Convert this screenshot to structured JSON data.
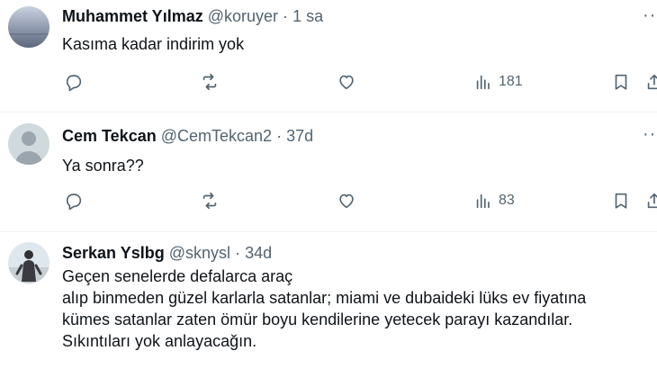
{
  "tweets": [
    {
      "name": "Muhammet Yılmaz",
      "handle": "@koruyer",
      "sep": "·",
      "time": "1 sa",
      "text": "Kasıma kadar indirim yok",
      "views": "181"
    },
    {
      "name": "Cem Tekcan",
      "handle": "@CemTekcan2",
      "sep": "·",
      "time": "37d",
      "text": "Ya sonra??",
      "views": "83"
    },
    {
      "name": "Serkan Yslbg",
      "handle": "@sknysl",
      "sep": "·",
      "time": "34d",
      "text": "Geçen senelerde defalarca araç\n alıp binmeden güzel karlarla satanlar; miami ve dubaideki lüks ev fiyatına\nkümes satanlar zaten ömür boyu kendilerine yetecek parayı kazandılar.\nSıkıntıları yok anlayacağın."
    }
  ],
  "more_label": "··",
  "icons": {
    "reply": "reply-icon",
    "retweet": "retweet-icon",
    "like": "like-icon",
    "views": "views-icon",
    "bookmark": "bookmark-icon",
    "share": "share-icon"
  },
  "colors": {
    "text": "#0f1419",
    "muted": "#536471",
    "separator": "#eff3f4"
  }
}
